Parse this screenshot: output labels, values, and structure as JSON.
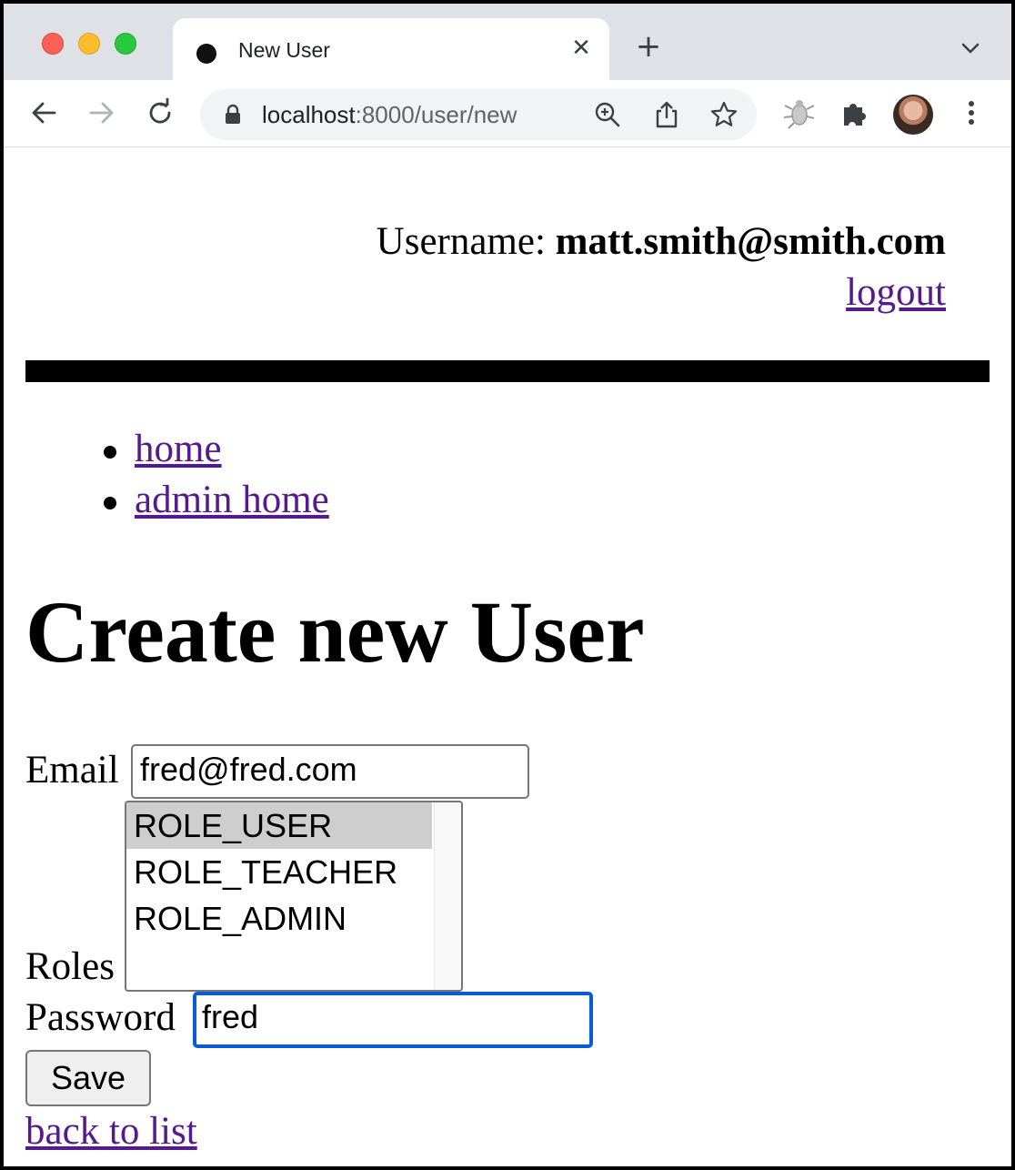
{
  "browser": {
    "tab": {
      "title": "New User"
    },
    "url": {
      "host": "localhost",
      "rest": ":8000/user/new"
    }
  },
  "header": {
    "username_label": "Username:",
    "username": "matt.smith@smith.com",
    "logout": "logout"
  },
  "nav": {
    "items": [
      "home",
      "admin home"
    ]
  },
  "main": {
    "title": "Create new User",
    "form": {
      "email_label": "Email",
      "email_value": "fred@fred.com",
      "roles_label": "Roles",
      "roles_options": [
        "ROLE_USER",
        "ROLE_TEACHER",
        "ROLE_ADMIN"
      ],
      "roles_selected": "ROLE_USER",
      "password_label": "Password",
      "password_value": "fred",
      "save": "Save"
    },
    "back_link": "back to list"
  },
  "colors": {
    "link": "#551a8b",
    "focus_ring": "#0a5cd6",
    "selected_option": "#cecece"
  },
  "icons": [
    "close-icon",
    "plus-icon",
    "chevron-down-icon",
    "back-arrow-icon",
    "forward-arrow-icon",
    "reload-icon",
    "lock-icon",
    "zoom-icon",
    "share-icon",
    "star-icon",
    "bug-extension-icon",
    "puzzle-extensions-icon",
    "avatar",
    "kebab-menu-icon"
  ]
}
